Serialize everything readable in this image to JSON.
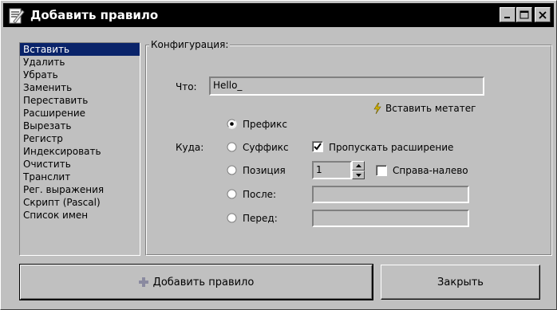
{
  "window": {
    "title": "Добавить правило"
  },
  "rules": [
    "Вставить",
    "Удалить",
    "Убрать",
    "Заменить",
    "Переставить",
    "Расширение",
    "Вырезать",
    "Регистр",
    "Индексировать",
    "Очистить",
    "Транслит",
    "Рег. выражения",
    "Скрипт (Pascal)",
    "Список имен"
  ],
  "selected_rule": "Вставить",
  "config": {
    "group_label": "Конфигурация:",
    "what_label": "Что:",
    "what_value": "Hello_",
    "insert_meta_label": "Вставить метатег",
    "where_label": "Куда:",
    "options": {
      "prefix": "Префикс",
      "suffix": "Суффикс",
      "position": "Позиция",
      "after": "После:",
      "before": "Перед:"
    },
    "selected_option": "prefix",
    "skip_extension_label": "Пропускать расширение",
    "skip_extension_checked": true,
    "position_value": "1",
    "right_to_left_label": "Справа-налево",
    "right_to_left_checked": false,
    "after_value": "",
    "before_value": ""
  },
  "buttons": {
    "add_rule": "Добавить правило",
    "close": "Закрыть"
  },
  "colors": {
    "window_bg": "#c0c0c0",
    "titlebar_bg": "#000000",
    "selection_bg": "#0a246a",
    "add_icon": "#8a8aa0",
    "meta_icon": "#d0b000"
  }
}
